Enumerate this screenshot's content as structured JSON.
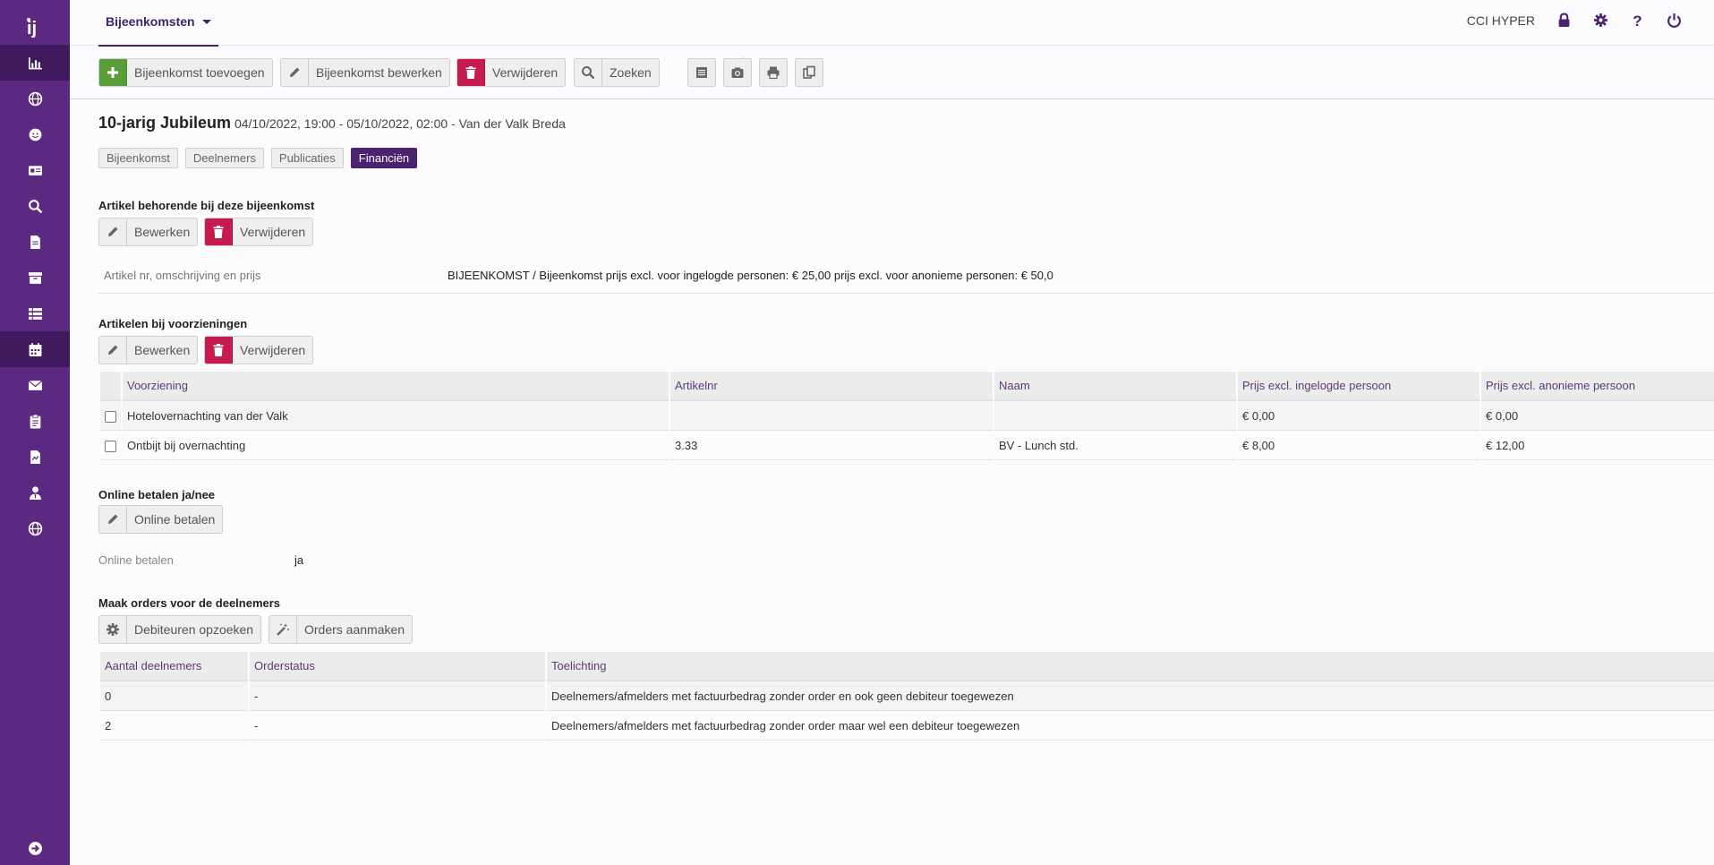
{
  "colors": {
    "sidebar": "#5b2a80",
    "accent": "#4b2270",
    "add": "#5a9e3a",
    "delete": "#c51b4e"
  },
  "sidebar": {
    "items": [
      {
        "icon": "chart-bar-icon",
        "active": true
      },
      {
        "icon": "globe-icon"
      },
      {
        "icon": "smile-icon"
      },
      {
        "icon": "id-card-icon"
      },
      {
        "icon": "search-icon"
      },
      {
        "icon": "file-icon"
      },
      {
        "icon": "archive-icon"
      },
      {
        "icon": "table-icon"
      },
      {
        "icon": "calendar-icon",
        "active": true
      },
      {
        "icon": "envelope-icon"
      },
      {
        "icon": "clipboard-icon"
      },
      {
        "icon": "file-alt-icon"
      },
      {
        "icon": "user-tie-icon"
      },
      {
        "icon": "globe-icon"
      }
    ],
    "bottom_icon": "sign-out-icon"
  },
  "header": {
    "tab": "Bijeenkomsten",
    "user": "CCI HYPER",
    "icons": [
      "lock-icon",
      "gear-icon",
      "question-icon",
      "power-icon"
    ]
  },
  "toolbar": {
    "add": "Bijeenkomst toevoegen",
    "edit": "Bijeenkomst bewerken",
    "delete": "Verwijderen",
    "search": "Zoeken",
    "icons": [
      "list-icon",
      "camera-icon",
      "print-icon",
      "copy-icon"
    ]
  },
  "event": {
    "title": "10-jarig Jubileum",
    "details": "04/10/2022, 19:00 - 05/10/2022, 02:00 - Van der Valk Breda"
  },
  "tabs": [
    "Bijeenkomst",
    "Deelnemers",
    "Publicaties",
    "Financiën"
  ],
  "active_tab": "Financiën",
  "article_section": {
    "heading": "Artikel behorende bij deze bijeenkomst",
    "edit": "Bewerken",
    "delete": "Verwijderen",
    "label": "Artikel nr, omschrijving en prijs",
    "value": "BIJEENKOMST / Bijeenkomst prijs excl. voor ingelogde personen: € 25,00 prijs excl. voor anonieme personen: € 50,0"
  },
  "facilities_section": {
    "heading": "Artikelen bij voorzieningen",
    "edit": "Bewerken",
    "delete": "Verwijderen",
    "columns": [
      "Voorziening",
      "Artikelnr",
      "Naam",
      "Prijs excl. ingelogde persoon",
      "Prijs excl. anonieme persoon"
    ],
    "rows": [
      [
        "Hotelovernachting van der Valk",
        "",
        "",
        "€ 0,00",
        "€ 0,00"
      ],
      [
        "Ontbijt bij overnachting",
        "3.33",
        "BV - Lunch std.",
        "€ 8,00",
        "€ 12,00"
      ]
    ]
  },
  "payment_section": {
    "heading": "Online betalen ja/nee",
    "button": "Online betalen",
    "label": "Online betalen",
    "value": "ja"
  },
  "orders_section": {
    "heading": "Maak orders voor de deelnemers",
    "lookup": "Debiteuren opzoeken",
    "create": "Orders aanmaken",
    "columns": [
      "Aantal deelnemers",
      "Orderstatus",
      "Toelichting"
    ],
    "rows": [
      [
        "0",
        "-",
        "Deelnemers/afmelders met factuurbedrag zonder order en ook geen debiteur toegewezen"
      ],
      [
        "2",
        "-",
        "Deelnemers/afmelders met factuurbedrag zonder order maar wel een debiteur toegewezen"
      ]
    ]
  }
}
